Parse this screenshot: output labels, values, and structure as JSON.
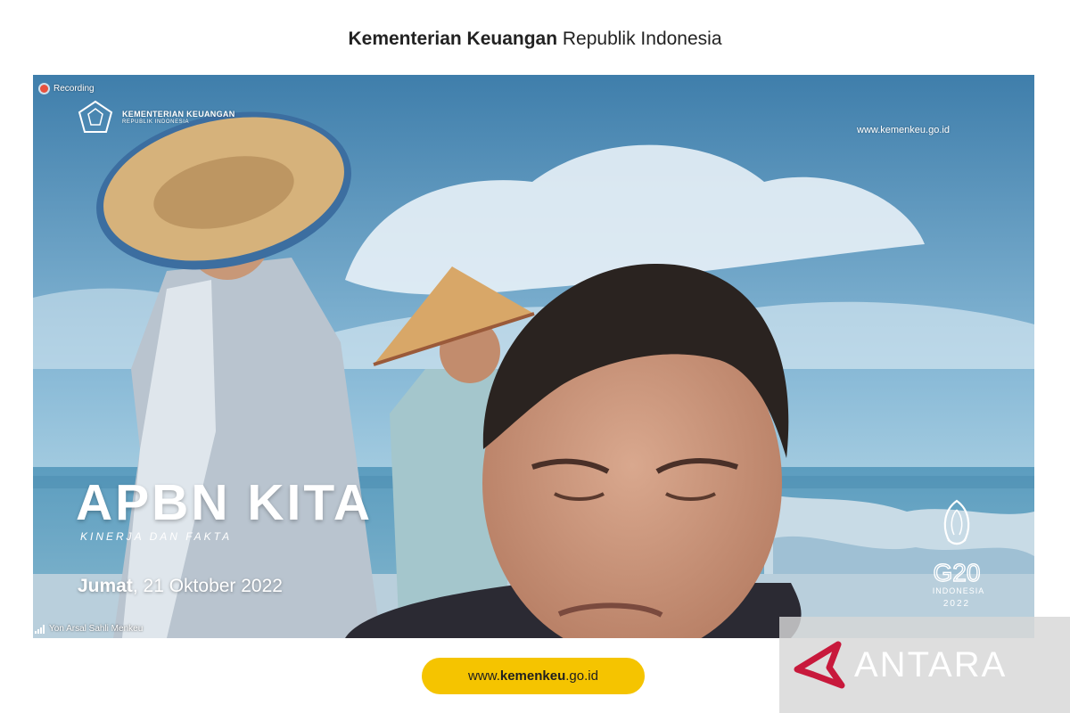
{
  "header": {
    "title_bold": "Kementerian Keuangan",
    "title_light": " Republik Indonesia"
  },
  "video": {
    "recording_label": "Recording",
    "ministry_logo": {
      "line1": "KEMENTERIAN KEUANGAN",
      "line2": "REPUBLIK INDONESIA"
    },
    "overlay_url": "www.kemenkeu.go.id",
    "program_title": "APBN KITA",
    "program_subtitle": "KINERJA DAN FAKTA",
    "date_day": "Jumat",
    "date_rest": ", 21 Oktober 2022",
    "g20_logo": {
      "text": "G20",
      "country": "INDONESIA",
      "year": "2022"
    },
    "participant_name": "Yon Arsal Sahli Menkeu"
  },
  "footer": {
    "url_prefix": "www.",
    "url_bold": "kemenkeu",
    "url_suffix": ".go.id"
  },
  "watermark": {
    "text": "ANTARA"
  },
  "colors": {
    "pill": "#f5c400",
    "sky": "#6fa6c6",
    "recording": "#e8513d",
    "antara_mark": "#c8193c"
  },
  "icons": [
    "recording-icon",
    "ministry-emblem-icon",
    "signal-bars-icon",
    "antara-logo-icon",
    "g20-emblem-icon"
  ]
}
